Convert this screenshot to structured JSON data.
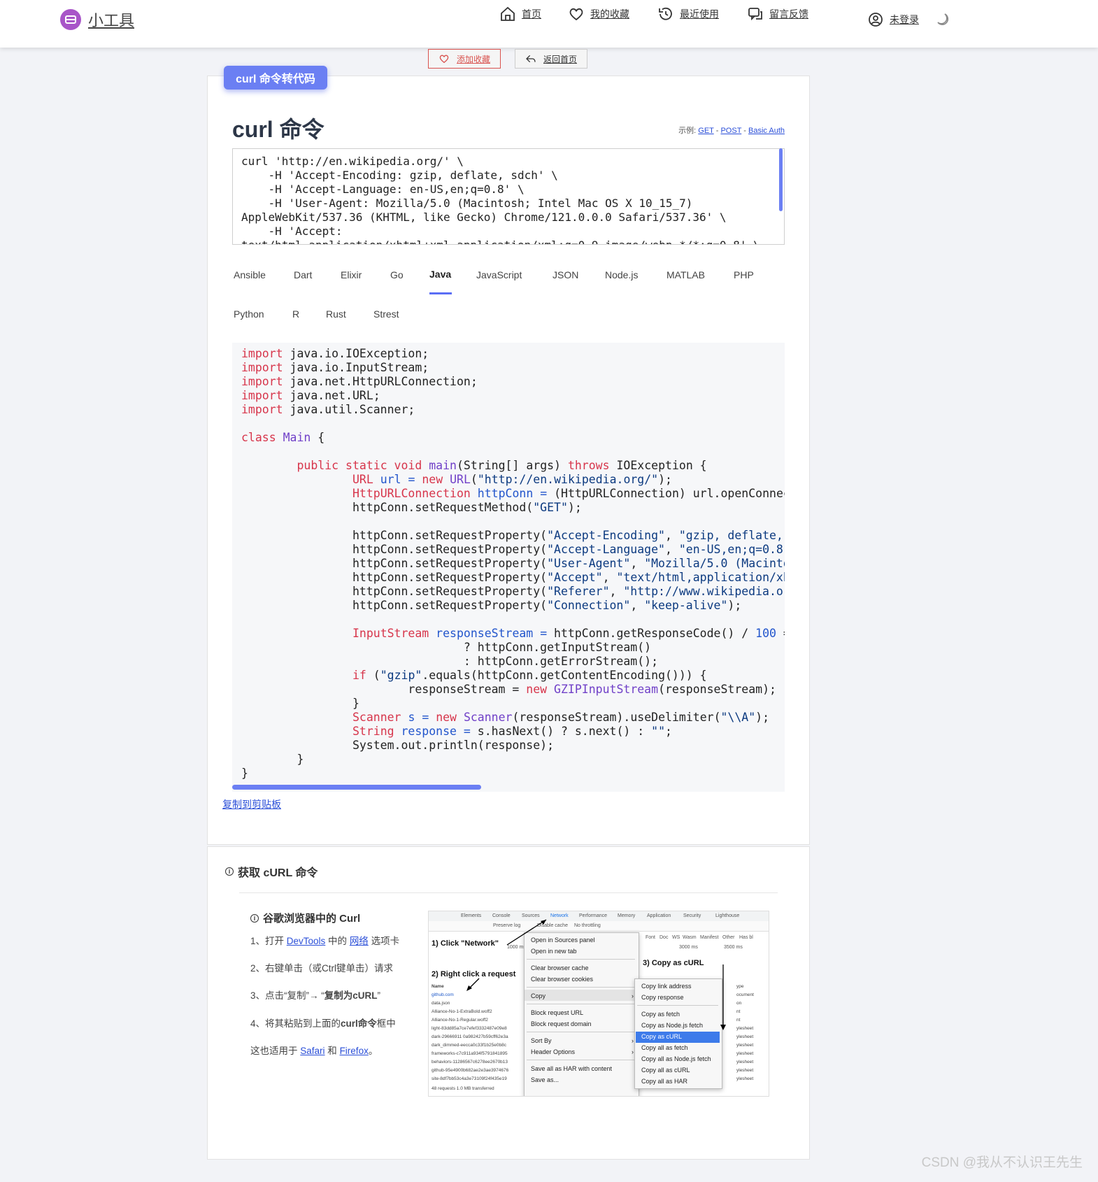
{
  "header": {
    "logo_text": "小工具",
    "nav": [
      {
        "label": "首页",
        "icon": "home-icon"
      },
      {
        "label": "我的收藏",
        "icon": "heart-icon"
      },
      {
        "label": "最近使用",
        "icon": "history-icon"
      },
      {
        "label": "留言反馈",
        "icon": "feedback-icon"
      }
    ],
    "login_label": "未登录",
    "theme_icon": "moon-icon"
  },
  "actions": {
    "favorite_label": "添加收藏",
    "back_label": "返回首页"
  },
  "tool": {
    "badge": "curl 命令转代码",
    "title": "curl 命令",
    "examples_prefix": "示例:",
    "examples": [
      "GET",
      "POST",
      "Basic Auth"
    ],
    "curl_input": "curl 'http://en.wikipedia.org/' \\\n    -H 'Accept-Encoding: gzip, deflate, sdch' \\\n    -H 'Accept-Language: en-US,en;q=0.8' \\\n    -H 'User-Agent: Mozilla/5.0 (Macintosh; Intel Mac OS X 10_15_7)\nAppleWebKit/537.36 (KHTML, like Gecko) Chrome/121.0.0.0 Safari/537.36' \\\n    -H 'Accept:\ntext/html,application/xhtml+xml,application/xml;q=0.9,image/webp,*/*;q=0.8' \\",
    "languages_row1": [
      "Ansible",
      "Dart",
      "Elixir",
      "Go",
      "Java",
      "JavaScript",
      "JSON",
      "Node.js",
      "MATLAB",
      "PHP"
    ],
    "languages_row2": [
      "Python",
      "R",
      "Rust",
      "Strest"
    ],
    "active_language": "Java",
    "copy_label": "复制到剪贴板"
  },
  "howto": {
    "title": "获取 cURL 命令",
    "chrome_title": "谷歌浏览器中的 Curl",
    "step1_a": "1、打开 ",
    "step1_link1": "DevTools",
    "step1_b": " 中的 ",
    "step1_link2": "网络",
    "step1_c": " 选项卡",
    "step2": "2、右键单击（或Ctrl键单击）请求",
    "step3_a": "3、点击“复制”→ “",
    "step3_bold": "复制为cURL",
    "step3_b": "”",
    "step4_a": "4、将其粘贴到上面的",
    "step4_bold": "curl命令",
    "step4_b": "框中",
    "also_a": "这也适用于 ",
    "also_link1": "Safari",
    "also_b": " 和 ",
    "also_link2": "Firefox",
    "also_c": "。",
    "screenshot": {
      "tabs": [
        "Elements",
        "Console",
        "Sources",
        "Network",
        "Performance",
        "Memory",
        "Application",
        "Security",
        "Lighthouse"
      ],
      "toolbar": [
        "Preserve log",
        "Disable cache",
        "No throttling"
      ],
      "filter_tabs": [
        "Font",
        "Doc",
        "WS",
        "Wasm",
        "Manifest",
        "Other",
        "Has bl"
      ],
      "anno1": "1) Click \"Network\"",
      "anno2": "2) Right click a request",
      "anno3": "3) Copy as cURL",
      "menu1": [
        "Open in Sources panel",
        "Open in new tab",
        "Clear browser cache",
        "Clear browser cookies",
        "Copy",
        "Block request URL",
        "Block request domain",
        "Sort By",
        "Header Options",
        "Save all as HAR with content",
        "Save as..."
      ],
      "menu2": [
        "Copy link address",
        "Copy response",
        "Copy as fetch",
        "Copy as Node.js fetch",
        "Copy as cURL",
        "Copy all as fetch",
        "Copy all as Node.js fetch",
        "Copy all as cURL",
        "Copy all as HAR"
      ],
      "requests": [
        "github.com",
        "data.json",
        "Alliance-No-1-ExtraBold.woff2",
        "Alliance-No-1-Regular.woff2",
        "light-83dd85a7ce7efef3332487e09e8",
        "dark-29666911 0a982427b59cff62e3a",
        "dark_dimmed-eecca0c33f1b25e0b8c",
        "frameworks-c7c911a934f5791841895",
        "behaviors-11286567c6278ee2670b13",
        "github-95e4900b682ae2e3ae3974676",
        "site-8df7bb53c4a3e73109f24f435e19"
      ],
      "name_header": "Name",
      "status": "48 requests  1.0 MB transferred",
      "times": [
        "1000 ms",
        "3000 ms",
        "3500 ms"
      ],
      "types": [
        "ype",
        "ocument",
        "on",
        "nt",
        "nt",
        "ylesheet",
        "ylesheet",
        "ylesheet",
        "ylesheet",
        "ylesheet",
        "ylesheet",
        "ylesheet"
      ]
    }
  },
  "watermark": "CSDN @我从不认识王先生"
}
